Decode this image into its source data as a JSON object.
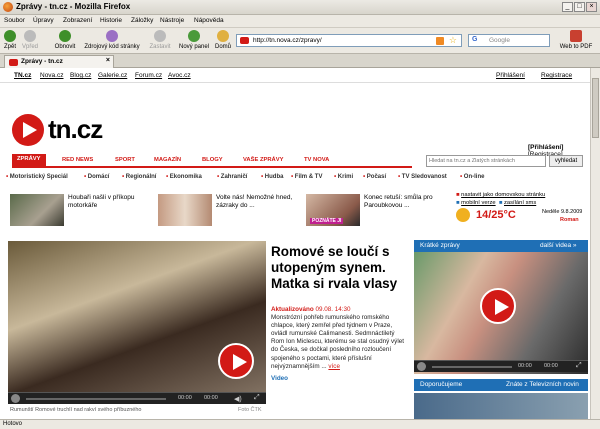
{
  "window": {
    "title": "Zprávy - tn.cz - Mozilla Firefox"
  },
  "menu": [
    "Soubor",
    "Úpravy",
    "Zobrazení",
    "Historie",
    "Záložky",
    "Nástroje",
    "Nápověda"
  ],
  "toolbar": {
    "back": "Zpět",
    "forward": "Vpřed",
    "reload": "Obnovit",
    "source": "Zdrojový kód stránky",
    "stop": "Zastavit",
    "new_panel": "Nový panel",
    "home": "Domů",
    "pdf": "Web to PDF"
  },
  "address": {
    "url": "http://tn.nova.cz/zpravy/"
  },
  "search": {
    "placeholder": "Google"
  },
  "tab": {
    "title": "Zprávy - tn.cz"
  },
  "site_links": [
    "TN.cz",
    "Nova.cz",
    "Blog.cz",
    "Galerie.cz",
    "Forum.cz",
    "Avoc.cz"
  ],
  "login": {
    "top_login": "Přihlášení",
    "top_register": "Registrace",
    "logo": "tn.cz",
    "bracket_login": "[Přihlášení]",
    "bracket_register": "[Registrace]"
  },
  "nav": [
    "ZPRÁVY",
    "RED NEWS",
    "SPORT",
    "MAGAZÍN",
    "BLOGY",
    "VAŠE ZPRÁVY",
    "TV NOVA"
  ],
  "site_search": {
    "placeholder": "Hledat na tn.cz a Zlatých stránkách",
    "button": "vyhledat"
  },
  "subnav": [
    "Motoristický Speciál",
    "Domácí",
    "Regionální",
    "Ekonomika",
    "Zahraničí",
    "Hudba",
    "Film & TV",
    "Krimi",
    "Počasí",
    "TV Sledovanost",
    "On-line"
  ],
  "teasers": [
    {
      "title": "Houbaři našli v příkopu motorkáře"
    },
    {
      "title": "Volte nás! Nemožné hned, zázraky do ..."
    },
    {
      "title": "Konec retuší: smůla pro Paroubkovou ..."
    }
  ],
  "widget": {
    "home_link": "nastavit jako domovskou stránku",
    "mobile": "mobilní verze",
    "sms": "zasílání sms",
    "date": "Neděle 9.8.2009",
    "name": "Roman",
    "temp": "14/25°C",
    "recognize": "POZNÁTE JI"
  },
  "main_article": {
    "headline": "Romové se loučí s utopeným synem. Matka si rvala vlasy",
    "updated": "Aktualizováno",
    "datetime": "09.08. 14:30",
    "body": "Monstrózní pohřeb rumunského romského chlapce, který zemřel před týdnem v Praze, ovládl rumunské Calimanesti. Sedmnáctiletý Rom Ion Miclescu, kterému se stal osudný výlet do Česka, se dočkal posledního rozloučení spojeného s poctami, které příslušní nejvýznamnějším ...",
    "more": "více",
    "video_label": "Video",
    "caption": "Rumunští Romové truchlí nad rakví svého příbuzného",
    "photo": "Foto ČTK"
  },
  "player": {
    "time_main": "00:00",
    "time_main2": "00:00",
    "time_side": "00:00",
    "time_side2": "00:00"
  },
  "sidebar": {
    "kratke": "Krátké zprávy",
    "dalsi": "další videa",
    "doporuceno": "Doporučujeme",
    "znate": "Znáte z Televizních novin"
  },
  "status": "Hotovo",
  "colors": {
    "brand_red": "#d21a16",
    "sidebar_blue": "#1f6fb5"
  }
}
